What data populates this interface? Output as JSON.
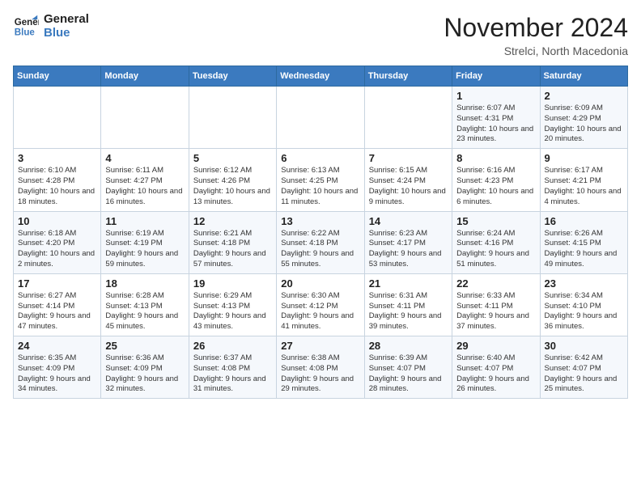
{
  "header": {
    "logo_line1": "General",
    "logo_line2": "Blue",
    "month": "November 2024",
    "location": "Strelci, North Macedonia"
  },
  "days_of_week": [
    "Sunday",
    "Monday",
    "Tuesday",
    "Wednesday",
    "Thursday",
    "Friday",
    "Saturday"
  ],
  "weeks": [
    [
      {
        "day": "",
        "info": ""
      },
      {
        "day": "",
        "info": ""
      },
      {
        "day": "",
        "info": ""
      },
      {
        "day": "",
        "info": ""
      },
      {
        "day": "",
        "info": ""
      },
      {
        "day": "1",
        "info": "Sunrise: 6:07 AM\nSunset: 4:31 PM\nDaylight: 10 hours and 23 minutes."
      },
      {
        "day": "2",
        "info": "Sunrise: 6:09 AM\nSunset: 4:29 PM\nDaylight: 10 hours and 20 minutes."
      }
    ],
    [
      {
        "day": "3",
        "info": "Sunrise: 6:10 AM\nSunset: 4:28 PM\nDaylight: 10 hours and 18 minutes."
      },
      {
        "day": "4",
        "info": "Sunrise: 6:11 AM\nSunset: 4:27 PM\nDaylight: 10 hours and 16 minutes."
      },
      {
        "day": "5",
        "info": "Sunrise: 6:12 AM\nSunset: 4:26 PM\nDaylight: 10 hours and 13 minutes."
      },
      {
        "day": "6",
        "info": "Sunrise: 6:13 AM\nSunset: 4:25 PM\nDaylight: 10 hours and 11 minutes."
      },
      {
        "day": "7",
        "info": "Sunrise: 6:15 AM\nSunset: 4:24 PM\nDaylight: 10 hours and 9 minutes."
      },
      {
        "day": "8",
        "info": "Sunrise: 6:16 AM\nSunset: 4:23 PM\nDaylight: 10 hours and 6 minutes."
      },
      {
        "day": "9",
        "info": "Sunrise: 6:17 AM\nSunset: 4:21 PM\nDaylight: 10 hours and 4 minutes."
      }
    ],
    [
      {
        "day": "10",
        "info": "Sunrise: 6:18 AM\nSunset: 4:20 PM\nDaylight: 10 hours and 2 minutes."
      },
      {
        "day": "11",
        "info": "Sunrise: 6:19 AM\nSunset: 4:19 PM\nDaylight: 9 hours and 59 minutes."
      },
      {
        "day": "12",
        "info": "Sunrise: 6:21 AM\nSunset: 4:18 PM\nDaylight: 9 hours and 57 minutes."
      },
      {
        "day": "13",
        "info": "Sunrise: 6:22 AM\nSunset: 4:18 PM\nDaylight: 9 hours and 55 minutes."
      },
      {
        "day": "14",
        "info": "Sunrise: 6:23 AM\nSunset: 4:17 PM\nDaylight: 9 hours and 53 minutes."
      },
      {
        "day": "15",
        "info": "Sunrise: 6:24 AM\nSunset: 4:16 PM\nDaylight: 9 hours and 51 minutes."
      },
      {
        "day": "16",
        "info": "Sunrise: 6:26 AM\nSunset: 4:15 PM\nDaylight: 9 hours and 49 minutes."
      }
    ],
    [
      {
        "day": "17",
        "info": "Sunrise: 6:27 AM\nSunset: 4:14 PM\nDaylight: 9 hours and 47 minutes."
      },
      {
        "day": "18",
        "info": "Sunrise: 6:28 AM\nSunset: 4:13 PM\nDaylight: 9 hours and 45 minutes."
      },
      {
        "day": "19",
        "info": "Sunrise: 6:29 AM\nSunset: 4:13 PM\nDaylight: 9 hours and 43 minutes."
      },
      {
        "day": "20",
        "info": "Sunrise: 6:30 AM\nSunset: 4:12 PM\nDaylight: 9 hours and 41 minutes."
      },
      {
        "day": "21",
        "info": "Sunrise: 6:31 AM\nSunset: 4:11 PM\nDaylight: 9 hours and 39 minutes."
      },
      {
        "day": "22",
        "info": "Sunrise: 6:33 AM\nSunset: 4:11 PM\nDaylight: 9 hours and 37 minutes."
      },
      {
        "day": "23",
        "info": "Sunrise: 6:34 AM\nSunset: 4:10 PM\nDaylight: 9 hours and 36 minutes."
      }
    ],
    [
      {
        "day": "24",
        "info": "Sunrise: 6:35 AM\nSunset: 4:09 PM\nDaylight: 9 hours and 34 minutes."
      },
      {
        "day": "25",
        "info": "Sunrise: 6:36 AM\nSunset: 4:09 PM\nDaylight: 9 hours and 32 minutes."
      },
      {
        "day": "26",
        "info": "Sunrise: 6:37 AM\nSunset: 4:08 PM\nDaylight: 9 hours and 31 minutes."
      },
      {
        "day": "27",
        "info": "Sunrise: 6:38 AM\nSunset: 4:08 PM\nDaylight: 9 hours and 29 minutes."
      },
      {
        "day": "28",
        "info": "Sunrise: 6:39 AM\nSunset: 4:07 PM\nDaylight: 9 hours and 28 minutes."
      },
      {
        "day": "29",
        "info": "Sunrise: 6:40 AM\nSunset: 4:07 PM\nDaylight: 9 hours and 26 minutes."
      },
      {
        "day": "30",
        "info": "Sunrise: 6:42 AM\nSunset: 4:07 PM\nDaylight: 9 hours and 25 minutes."
      }
    ]
  ]
}
